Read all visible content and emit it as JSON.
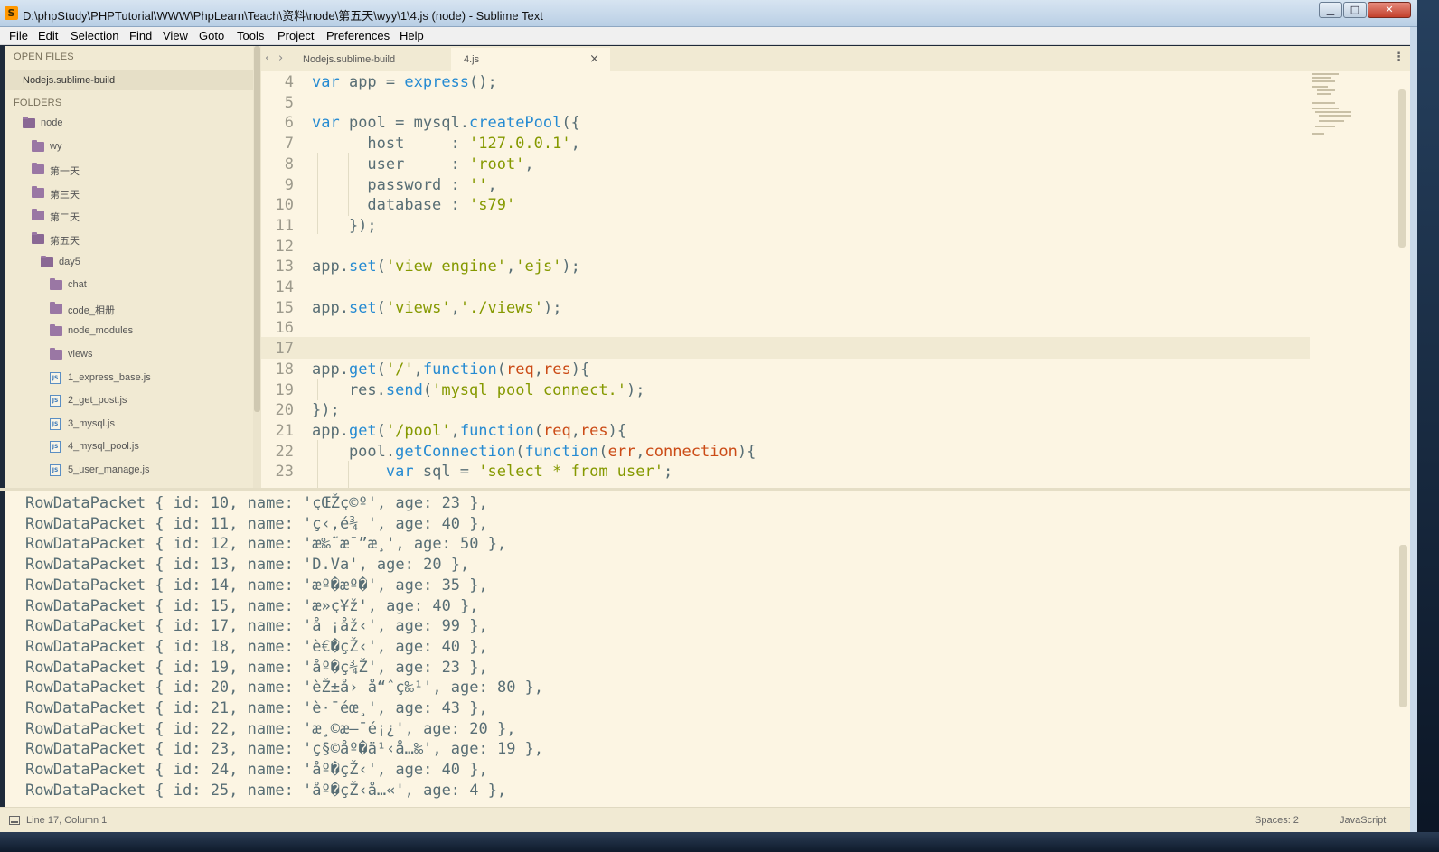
{
  "window": {
    "title": "D:\\phpStudy\\PHPTutorial\\WWW\\PhpLearn\\Teach\\资料\\node\\第五天\\wyy\\1\\4.js (node) - Sublime Text",
    "logo_glyph": "S",
    "minimize_glyph": "▁",
    "maximize_glyph": "□",
    "close_glyph": "✕"
  },
  "menu": [
    "File",
    "Edit",
    "Selection",
    "Find",
    "View",
    "Goto",
    "Tools",
    "Project",
    "Preferences",
    "Help"
  ],
  "sidebar": {
    "open_files_header": "OPEN FILES",
    "open_file": "Nodejs.sublime-build",
    "folders_header": "FOLDERS",
    "tree": [
      {
        "label": "node",
        "type": "folder-open",
        "depth": 0
      },
      {
        "label": "wy",
        "type": "folder",
        "depth": 1
      },
      {
        "label": "第一天",
        "type": "folder",
        "depth": 1
      },
      {
        "label": "第三天",
        "type": "folder",
        "depth": 1
      },
      {
        "label": "第二天",
        "type": "folder",
        "depth": 1
      },
      {
        "label": "第五天",
        "type": "folder-open",
        "depth": 1
      },
      {
        "label": "day5",
        "type": "folder-open",
        "depth": 2
      },
      {
        "label": "chat",
        "type": "folder",
        "depth": 3
      },
      {
        "label": "code_相册",
        "type": "folder",
        "depth": 3
      },
      {
        "label": "node_modules",
        "type": "folder",
        "depth": 3
      },
      {
        "label": "views",
        "type": "folder",
        "depth": 3
      },
      {
        "label": "1_express_base.js",
        "type": "js",
        "depth": 3
      },
      {
        "label": "2_get_post.js",
        "type": "js",
        "depth": 3
      },
      {
        "label": "3_mysql.js",
        "type": "js",
        "depth": 3
      },
      {
        "label": "4_mysql_pool.js",
        "type": "js",
        "depth": 3
      },
      {
        "label": "5_user_manage.js",
        "type": "js",
        "depth": 3
      }
    ],
    "js_icon_text": "JS"
  },
  "tabs": {
    "nav_prev": "‹",
    "nav_next": "›",
    "items": [
      {
        "label": "Nodejs.sublime-build",
        "active": false
      },
      {
        "label": "4.js",
        "active": true
      }
    ],
    "close_glyph": "×",
    "more_glyph": "⋮"
  },
  "editor": {
    "line_numbers": [
      "4",
      "5",
      "6",
      "7",
      "8",
      "9",
      "10",
      "11",
      "12",
      "13",
      "14",
      "15",
      "16",
      "17",
      "18",
      "19",
      "20",
      "21",
      "22",
      "23"
    ],
    "current_line": "17",
    "code_lines": [
      "var app = express();",
      "",
      "var pool = mysql.createPool({",
      "      host     : '127.0.0.1',",
      "      user     : 'root',",
      "      password : '',",
      "      database : 's79'",
      "    });",
      "",
      "app.set('view engine','ejs');",
      "",
      "app.set('views','./views');",
      "",
      "",
      "app.get('/',function(req,res){",
      "    res.send('mysql pool connect.');",
      "});",
      "app.get('/pool',function(req,res){",
      "    pool.getConnection(function(err,connection){",
      "        var sql = 'select * from user';"
    ]
  },
  "output": {
    "lines": [
      "RowDataPacket { id: 10, name: 'çŒŽç©º', age: 23 },",
      "RowDataPacket { id: 11, name: 'ç‹‚é¾ ', age: 40 },",
      "RowDataPacket { id: 12, name: 'æ‰˜æ¯”æ¸', age: 50 },",
      "RowDataPacket { id: 13, name: 'D.Va', age: 20 },",
      "RowDataPacket { id: 14, name: 'æº�æº�', age: 35 },",
      "RowDataPacket { id: 15, name: 'æ»ç¥ž', age: 40 },",
      "RowDataPacket { id: 17, name: 'å ¡åž‹', age: 99 },",
      "RowDataPacket { id: 18, name: 'è€�çŽ‹', age: 40 },",
      "RowDataPacket { id: 19, name: 'åº�ç¾Ž', age: 23 },",
      "RowDataPacket { id: 20, name: 'èŽ±å› å“ˆç‰¹', age: 80 },",
      "RowDataPacket { id: 21, name: 'è·¯éœ¸', age: 43 },",
      "RowDataPacket { id: 22, name: 'æ¸©æ–¯é¡¿', age: 20 },",
      "RowDataPacket { id: 23, name: 'ç§©åº�ä¹‹å…‰', age: 19 },",
      "RowDataPacket { id: 24, name: 'åº�çŽ‹', age: 40 },",
      "RowDataPacket { id: 25, name: 'åº�çŽ‹å…«', age: 4 },"
    ]
  },
  "status": {
    "position": "Line 17, Column 1",
    "indent": "Spaces: 2",
    "syntax": "JavaScript"
  },
  "colors": {
    "editor_bg": "#fcf5e3",
    "sidebar_bg": "#f1ead3",
    "keyword": "#268bd2",
    "string": "#859900",
    "param": "#cb4b16",
    "text": "#586e75"
  }
}
